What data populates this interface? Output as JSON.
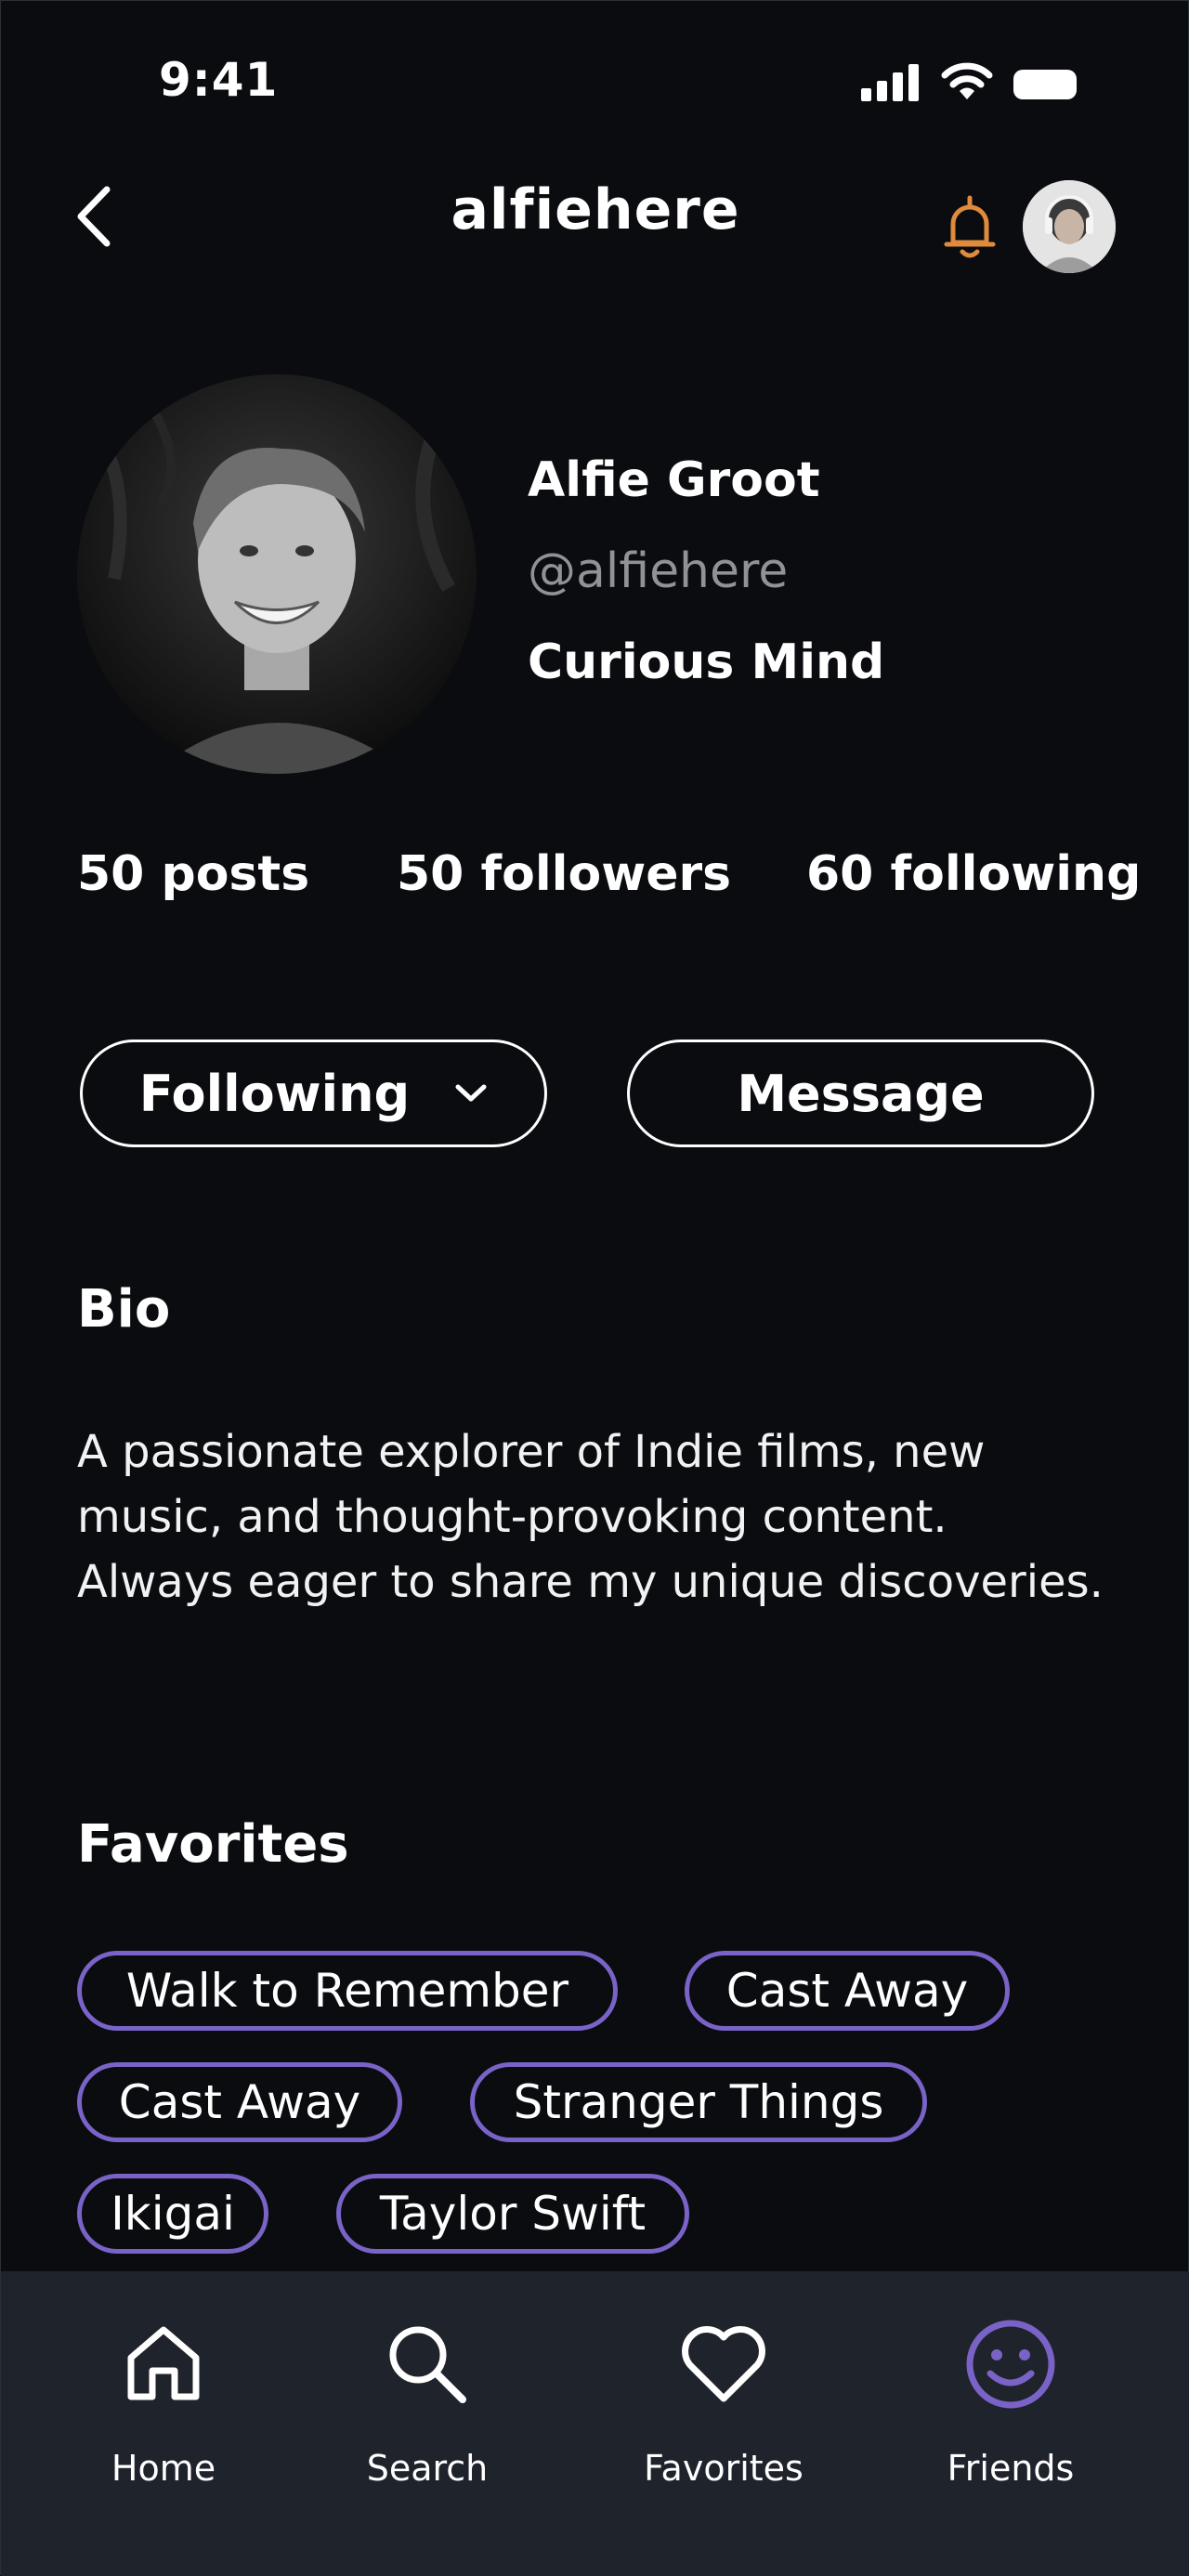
{
  "status_bar": {
    "time": "9:41"
  },
  "header": {
    "username": "alfiehere"
  },
  "profile": {
    "name": "Alfie Groot",
    "handle": "@alfiehere",
    "tagline": "Curious Mind"
  },
  "stats": {
    "posts": "50 posts",
    "followers": "50 followers",
    "following": "60 following"
  },
  "actions": {
    "following_label": "Following",
    "message_label": "Message"
  },
  "bio": {
    "title": "Bio",
    "text": "A passionate explorer of Indie films, new music, and thought-provoking content. Always eager to share my unique discoveries."
  },
  "favorites": {
    "title": "Favorites",
    "items": [
      "Walk to Remember",
      "Cast Away",
      "Cast Away",
      "Stranger Things",
      "Ikigai",
      "Taylor Swift"
    ]
  },
  "nav": {
    "items": [
      {
        "label": "Home",
        "icon": "home-icon"
      },
      {
        "label": "Search",
        "icon": "search-icon"
      },
      {
        "label": "Favorites",
        "icon": "heart-icon"
      },
      {
        "label": "Friends",
        "icon": "smiley-icon"
      }
    ],
    "active": "Friends"
  },
  "colors": {
    "background": "#0a0c10",
    "accent": "#7a63c7",
    "bell": "#e08a3c",
    "nav_background": "#1f232b",
    "muted_text": "#8f9398"
  }
}
